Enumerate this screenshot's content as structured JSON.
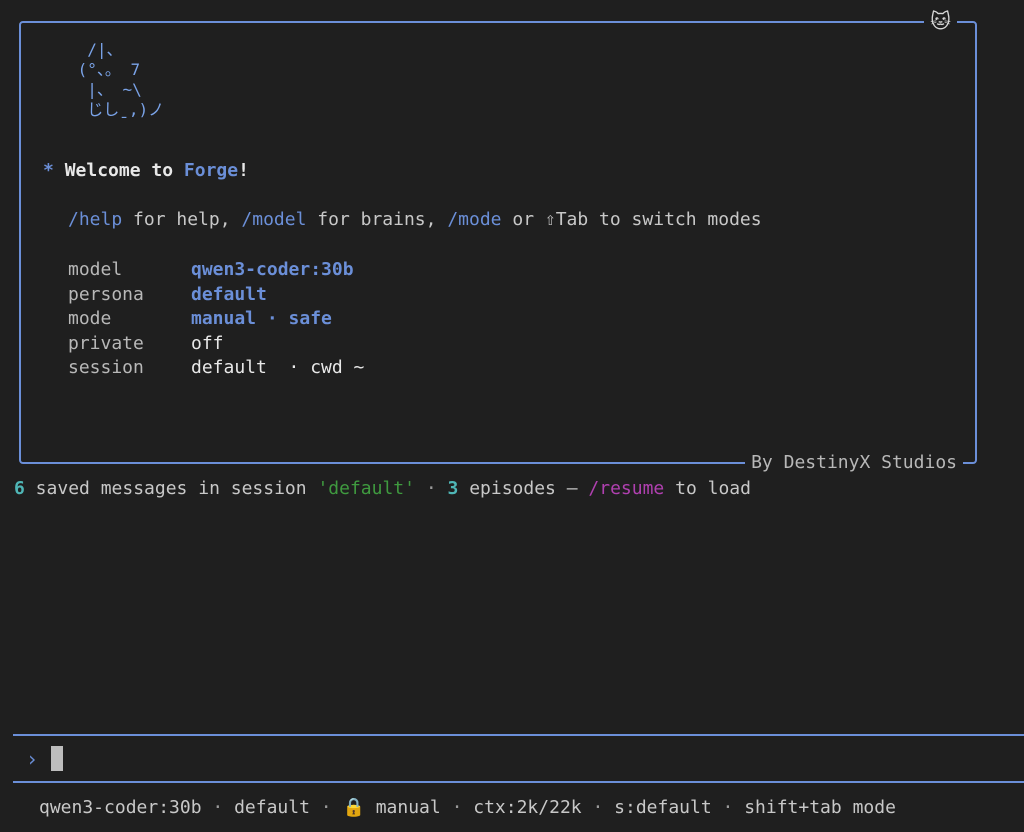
{
  "banner": {
    "cat_icon": "🐱",
    "ascii_art": [
      "  /|、",
      " (°、。 7",
      "  |、 ~\\",
      "  じしˍ,)ノ"
    ],
    "footer": "By DestinyX Studios"
  },
  "welcome": {
    "star": "*",
    "prefix": "Welcome to ",
    "name": "Forge",
    "suffix": "!"
  },
  "help": {
    "cmd_help": "/help",
    "text1": " for help, ",
    "cmd_model": "/model",
    "text2": " for brains, ",
    "cmd_mode": "/mode",
    "text3": " or ⇧Tab to switch modes"
  },
  "info": {
    "model": {
      "key": "model",
      "value": "qwen3-coder:30b"
    },
    "persona": {
      "key": "persona",
      "value": "default"
    },
    "mode": {
      "key": "mode",
      "value": "manual · safe"
    },
    "private": {
      "key": "private",
      "value": "off"
    },
    "session": {
      "key": "session",
      "value": "default  · cwd ~"
    }
  },
  "saved": {
    "count": "6",
    "text1": " saved messages in session ",
    "session_name": "'default'",
    "sep": " · ",
    "episodes_count": "3",
    "text2": " episodes — ",
    "resume_cmd": "/resume",
    "text3": " to load"
  },
  "input": {
    "prompt_symbol": "›",
    "value": ""
  },
  "status_bar": {
    "model": "qwen3-coder:30b",
    "sep1": " · ",
    "persona": "default",
    "sep2": " · ",
    "lock_icon": "🔒",
    "mode": " manual",
    "sep3": " · ",
    "ctx": "ctx:2k/22k",
    "sep4": " · ",
    "session": "s:default",
    "sep5": " · ",
    "hint": "shift+tab mode"
  },
  "colors": {
    "accent": "#6b8fd8",
    "background": "#1f1f1f",
    "teal": "#4fb6b6",
    "green": "#3f9a3f",
    "purple": "#b040b0"
  }
}
